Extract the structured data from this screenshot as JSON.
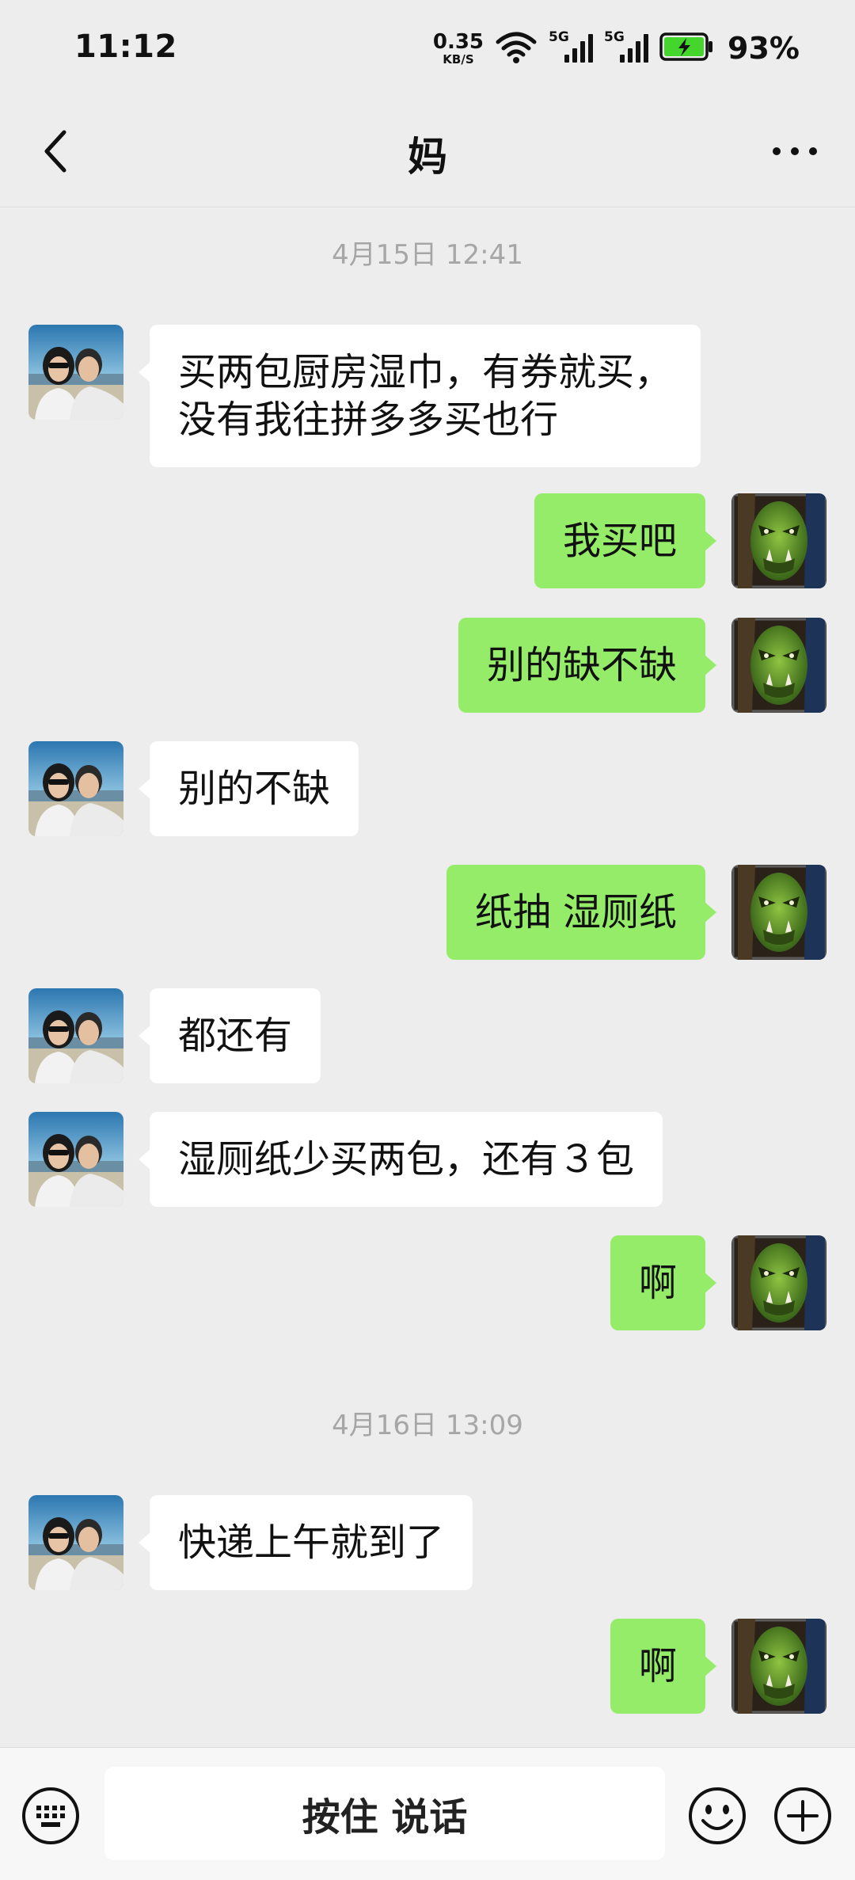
{
  "status_bar": {
    "time": "11:12",
    "net_speed_value": "0.35",
    "net_speed_unit": "KB/S",
    "sim1_label": "5G",
    "sim2_label": "5G",
    "battery_percent": "93%"
  },
  "header": {
    "title": "妈"
  },
  "messages": [
    {
      "kind": "timestamp",
      "text": "4月15日 12:41"
    },
    {
      "kind": "bubble",
      "side": "left",
      "text": "买两包厨房湿巾，有券就买，\n没有我往拼多多买也行"
    },
    {
      "kind": "bubble",
      "side": "right",
      "text": "我买吧"
    },
    {
      "kind": "bubble",
      "side": "right",
      "text": "别的缺不缺"
    },
    {
      "kind": "bubble",
      "side": "left",
      "text": "别的不缺"
    },
    {
      "kind": "bubble",
      "side": "right",
      "text": "纸抽 湿厕纸"
    },
    {
      "kind": "bubble",
      "side": "left",
      "text": "都还有"
    },
    {
      "kind": "bubble",
      "side": "left",
      "text": "湿厕纸少买两包，还有３包"
    },
    {
      "kind": "bubble",
      "side": "right",
      "text": "啊"
    },
    {
      "kind": "timestamp",
      "text": "4月16日 13:09"
    },
    {
      "kind": "bubble",
      "side": "left",
      "text": "快递上午就到了"
    },
    {
      "kind": "bubble",
      "side": "right",
      "text": "啊"
    }
  ],
  "input_bar": {
    "hold_to_talk_label": "按住 说话"
  },
  "icons": {
    "back": "chevron-left-icon",
    "more": "more-dots-icon",
    "keyboard": "keyboard-icon",
    "emoji": "smiley-icon",
    "plus": "plus-circle-icon"
  },
  "colors": {
    "background": "#ededed",
    "sent_bubble": "#95ec69",
    "received_bubble": "#ffffff",
    "timestamp_text": "#a6a6a6",
    "battery_fill": "#44d62c"
  }
}
